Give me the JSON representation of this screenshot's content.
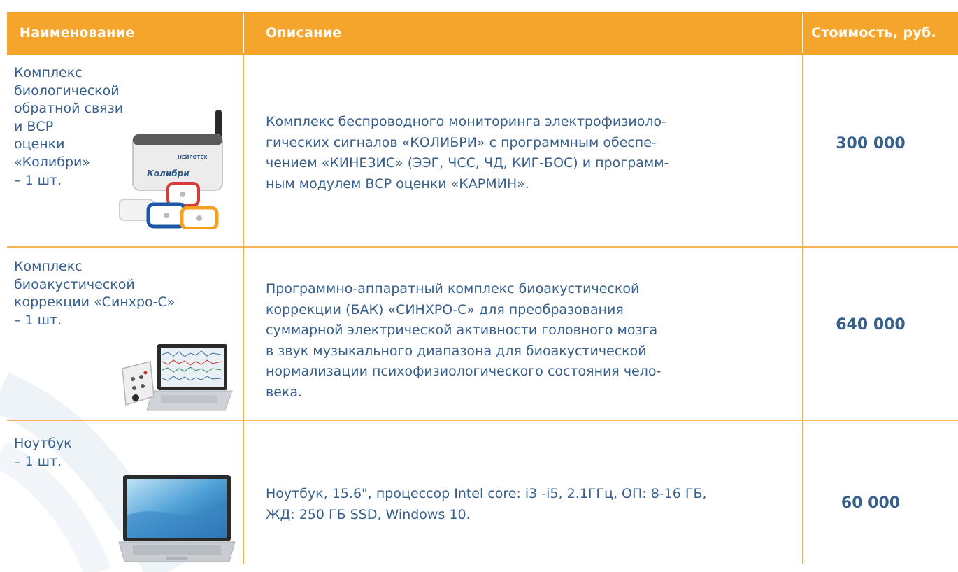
{
  "table": {
    "headers": {
      "name": "Наименование",
      "description": "Описание",
      "price": "Стоимость, руб."
    },
    "rows": [
      {
        "name_lines": [
          "Комплекс",
          "биологической",
          "обратной связи",
          "и ВСР",
          "оценки",
          "«Колибри»",
          "– 1 шт."
        ],
        "description_lines": [
          "Комплекс беспроводного мониторинга электрофизиоло-",
          "гических сигналов «КОЛИБРИ» с программным обеспе-",
          "чением «КИНЕЗИС» (ЭЭГ, ЧСС, ЧД, КИГ-БОС) и программ-",
          "ным модулем ВСР оценки «КАРМИН»."
        ],
        "price": "300 000",
        "device_brand": "НЕЙРОТЕХ",
        "device_label": "Колибри",
        "image_icon": "wireless-device-icon"
      },
      {
        "name_lines": [
          "Комплекс",
          "биоакустической",
          "коррекции «Синхро-С»",
          "– 1 шт."
        ],
        "description_lines": [
          "Программно-аппаратный комплекс биоакустической",
          "коррекции (БАК) «СИНХРО-С» для преобразования",
          "суммарной электрической активности головного мозга",
          "в звук музыкального диапазона для биоакустической",
          "нормализации психофизиологического состояния чело-",
          "века."
        ],
        "price": "640 000",
        "image_icon": "laptop-with-amplifier-icon"
      },
      {
        "name_lines": [
          "Ноутбук",
          "– 1 шт."
        ],
        "description_lines": [
          "Ноутбук, 15.6\", процессор Intel core: i3 -i5, 2.1ГГц, ОП: 8-16 ГБ,",
          "ЖД: 250 ГБ SSD, Windows 10."
        ],
        "price": "60 000",
        "image_icon": "laptop-icon"
      }
    ]
  },
  "colors": {
    "header_bg": "#f5a52b",
    "header_text": "#ffffff",
    "body_text": "#365f8c",
    "grid_line": "#f5b457"
  }
}
